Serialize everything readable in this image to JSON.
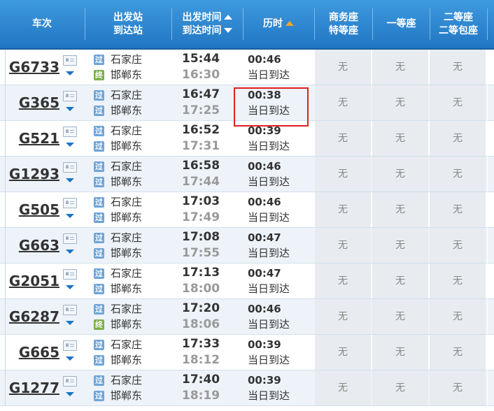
{
  "header": {
    "train_no": "车次",
    "depart_station": "出发站",
    "arrive_station": "到达站",
    "depart_time": "出发时间",
    "arrive_time": "到达时间",
    "duration": "历时",
    "business": "商务座",
    "premium": "特等座",
    "first": "一等座",
    "second": "二等座",
    "second_box": "二等包座"
  },
  "rows": [
    {
      "train": "G6733",
      "from_badge": "过",
      "from": "石家庄",
      "to_badge": "终",
      "to": "邯郸东",
      "dep": "15:44",
      "arr": "16:30",
      "dur": "00:46",
      "arrday": "当日到达",
      "business": "无",
      "first": "无",
      "second": "无"
    },
    {
      "train": "G365",
      "from_badge": "过",
      "from": "石家庄",
      "to_badge": "过",
      "to": "邯郸东",
      "dep": "16:47",
      "arr": "17:25",
      "dur": "00:38",
      "arrday": "当日到达",
      "business": "无",
      "first": "无",
      "second": "无"
    },
    {
      "train": "G521",
      "from_badge": "过",
      "from": "石家庄",
      "to_badge": "过",
      "to": "邯郸东",
      "dep": "16:52",
      "arr": "17:31",
      "dur": "00:39",
      "arrday": "当日到达",
      "business": "无",
      "first": "无",
      "second": "无"
    },
    {
      "train": "G1293",
      "from_badge": "过",
      "from": "石家庄",
      "to_badge": "过",
      "to": "邯郸东",
      "dep": "16:58",
      "arr": "17:44",
      "dur": "00:46",
      "arrday": "当日到达",
      "business": "无",
      "first": "无",
      "second": "无"
    },
    {
      "train": "G505",
      "from_badge": "过",
      "from": "石家庄",
      "to_badge": "过",
      "to": "邯郸东",
      "dep": "17:03",
      "arr": "17:49",
      "dur": "00:46",
      "arrday": "当日到达",
      "business": "无",
      "first": "无",
      "second": "无"
    },
    {
      "train": "G663",
      "from_badge": "过",
      "from": "石家庄",
      "to_badge": "过",
      "to": "邯郸东",
      "dep": "17:08",
      "arr": "17:55",
      "dur": "00:47",
      "arrday": "当日到达",
      "business": "无",
      "first": "无",
      "second": "无"
    },
    {
      "train": "G2051",
      "from_badge": "过",
      "from": "石家庄",
      "to_badge": "过",
      "to": "邯郸东",
      "dep": "17:13",
      "arr": "18:00",
      "dur": "00:47",
      "arrday": "当日到达",
      "business": "无",
      "first": "无",
      "second": "无"
    },
    {
      "train": "G6287",
      "from_badge": "过",
      "from": "石家庄",
      "to_badge": "终",
      "to": "邯郸东",
      "dep": "17:20",
      "arr": "18:06",
      "dur": "00:46",
      "arrday": "当日到达",
      "business": "无",
      "first": "无",
      "second": "无"
    },
    {
      "train": "G665",
      "from_badge": "过",
      "from": "石家庄",
      "to_badge": "过",
      "to": "邯郸东",
      "dep": "17:33",
      "arr": "18:12",
      "dur": "00:39",
      "arrday": "当日到达",
      "business": "无",
      "first": "无",
      "second": "无"
    },
    {
      "train": "G1277",
      "from_badge": "过",
      "from": "石家庄",
      "to_badge": "过",
      "to": "邯郸东",
      "dep": "17:40",
      "arr": "18:19",
      "dur": "00:39",
      "arrday": "当日到达",
      "business": "无",
      "first": "无",
      "second": "无"
    }
  ],
  "colors": {
    "header": "#2f88d4",
    "pass_badge": "#6ea5d8",
    "end_badge": "#7ab04b",
    "highlight": "#e02020",
    "sort_arrow": "#f5a623"
  },
  "icons": {
    "card": "passenger-card-icon",
    "expand": "chevron-down-icon"
  }
}
